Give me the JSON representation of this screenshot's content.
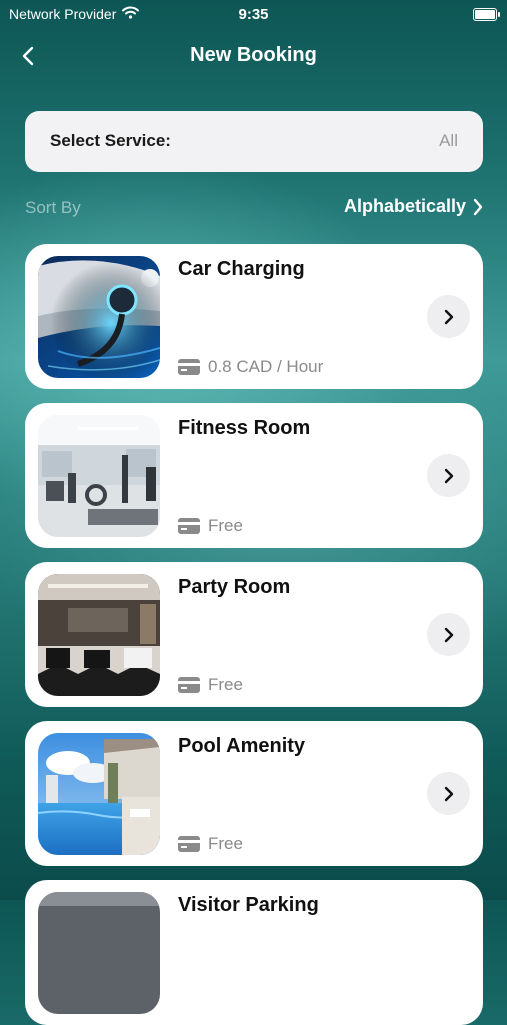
{
  "status_bar": {
    "carrier": "Network Provider",
    "time": "9:35"
  },
  "nav": {
    "title": "New Booking"
  },
  "service_select": {
    "label": "Select Service:",
    "value": "All"
  },
  "sort": {
    "label": "Sort By",
    "value": "Alphabetically"
  },
  "amenities": [
    {
      "name": "Car Charging",
      "price": "0.8 CAD / Hour"
    },
    {
      "name": "Fitness Room",
      "price": "Free"
    },
    {
      "name": "Party Room",
      "price": "Free"
    },
    {
      "name": "Pool Amenity",
      "price": "Free"
    },
    {
      "name": "Visitor Parking"
    }
  ],
  "icons": {
    "back": "chevron-left-icon",
    "sort": "chevron-right-icon",
    "wifi": "wifi-icon",
    "battery": "battery-icon",
    "card": "credit-card-icon",
    "row": "chevron-right-icon"
  }
}
